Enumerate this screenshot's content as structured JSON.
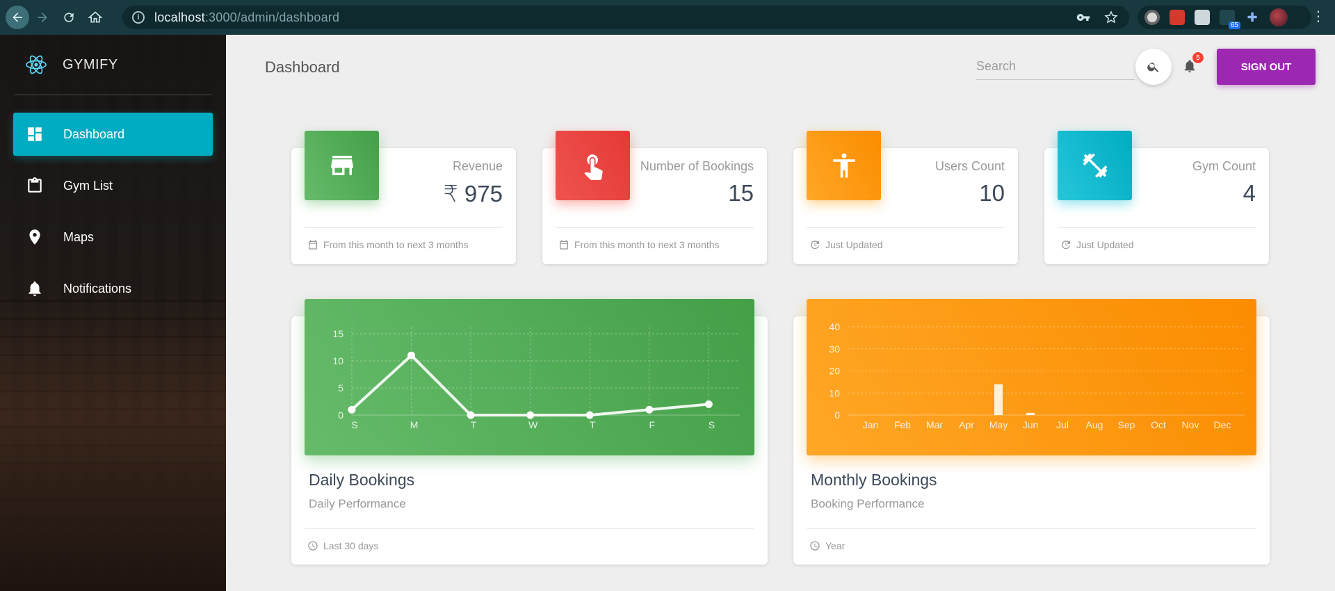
{
  "browser": {
    "url_host": "localhost",
    "url_path": ":3000/admin/dashboard",
    "extension_badge": "65"
  },
  "sidebar": {
    "logo_text": "GYMIFY",
    "items": [
      {
        "label": "Dashboard",
        "icon": "dashboard-icon",
        "active": true
      },
      {
        "label": "Gym List",
        "icon": "clipboard-icon",
        "active": false
      },
      {
        "label": "Maps",
        "icon": "location-pin-icon",
        "active": false
      },
      {
        "label": "Notifications",
        "icon": "bell-icon",
        "active": false
      }
    ]
  },
  "header": {
    "title": "Dashboard",
    "search_placeholder": "Search",
    "notification_count": "5",
    "signout_label": "SIGN OUT"
  },
  "stats": [
    {
      "label": "Revenue",
      "value": "₹ 975",
      "footer": "From this month to next 3 months",
      "footer_icon": "calendar-icon",
      "icon": "store-icon",
      "color": "#4caf50"
    },
    {
      "label": "Number of Bookings",
      "value": "15",
      "footer": "From this month to next 3 months",
      "footer_icon": "calendar-icon",
      "icon": "touch-icon",
      "color": "#f44336"
    },
    {
      "label": "Users Count",
      "value": "10",
      "footer": "Just Updated",
      "footer_icon": "update-icon",
      "icon": "accessibility-icon",
      "color": "#ff9800"
    },
    {
      "label": "Gym Count",
      "value": "4",
      "footer": "Just Updated",
      "footer_icon": "update-icon",
      "icon": "fitness-icon",
      "color": "#00bcd4"
    }
  ],
  "charts": {
    "daily": {
      "title": "Daily Bookings",
      "subtitle": "Daily Performance",
      "footer": "Last 30 days"
    },
    "monthly": {
      "title": "Monthly Bookings",
      "subtitle": "Booking Performance",
      "footer": "Year"
    }
  },
  "chart_data": [
    {
      "type": "line",
      "categories": [
        "S",
        "M",
        "T",
        "W",
        "T",
        "F",
        "S"
      ],
      "values": [
        1,
        11,
        0,
        0,
        0,
        1,
        2
      ],
      "ylim": [
        0,
        15
      ],
      "yticks": [
        0,
        5,
        10,
        15
      ],
      "grid": true
    },
    {
      "type": "bar",
      "categories": [
        "Jan",
        "Feb",
        "Mar",
        "Apr",
        "May",
        "Jun",
        "Jul",
        "Aug",
        "Sep",
        "Oct",
        "Nov",
        "Dec"
      ],
      "values": [
        0,
        0,
        0,
        0,
        14,
        1,
        0,
        0,
        0,
        0,
        0,
        0
      ],
      "ylim": [
        0,
        40
      ],
      "yticks": [
        0,
        10,
        20,
        30,
        40
      ],
      "grid": true
    }
  ]
}
